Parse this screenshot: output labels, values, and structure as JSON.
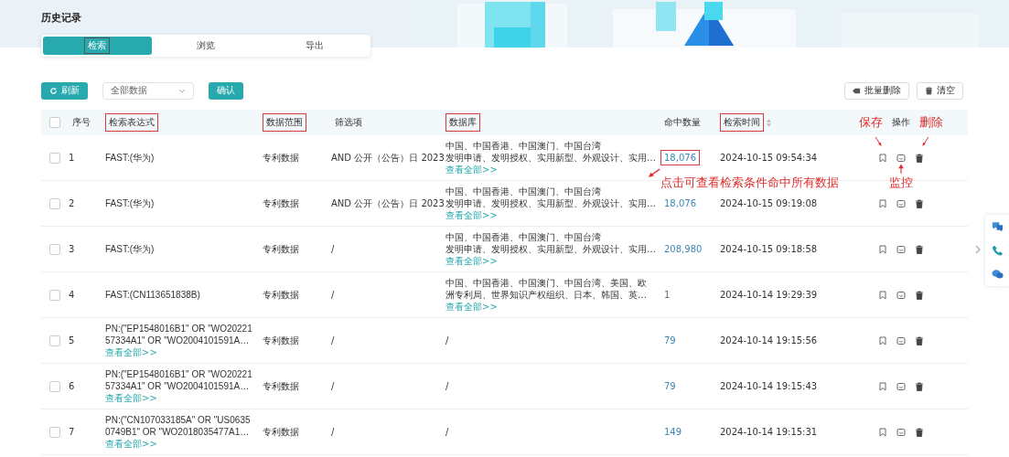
{
  "page": {
    "title": "历史记录"
  },
  "tabs": [
    {
      "label": "检索",
      "selected": true,
      "highlighted": true
    },
    {
      "label": "浏览",
      "selected": false,
      "highlighted": false
    },
    {
      "label": "导出",
      "selected": false,
      "highlighted": false
    }
  ],
  "toolbar": {
    "refresh": "刷新",
    "scope_select": {
      "value": "全部数据"
    },
    "confirm": "确认",
    "batch_delete": "批量删除",
    "clear": "清空"
  },
  "table": {
    "all_checked": false,
    "columns": [
      {
        "label": "序号",
        "highlighted": false,
        "sortable": false
      },
      {
        "label": "检索表达式",
        "highlighted": true,
        "sortable": false
      },
      {
        "label": "数据范围",
        "highlighted": true,
        "sortable": false
      },
      {
        "label": "筛选项",
        "highlighted": false,
        "sortable": false
      },
      {
        "label": "数据库",
        "highlighted": true,
        "sortable": false
      },
      {
        "label": "命中数量",
        "highlighted": false,
        "sortable": false
      },
      {
        "label": "检索时间",
        "highlighted": true,
        "sortable": true
      },
      {
        "label": "操作",
        "highlighted": false,
        "sortable": false
      }
    ],
    "rows": [
      {
        "checked": false,
        "index": "1",
        "expression": [
          "FAST:(华为)"
        ],
        "scope": "专利数据",
        "filter": "AND 公开（公告）日 2023",
        "database": [
          "中国、中国香港、中国澳门、中国台湾",
          "发明申请、发明授权、实用新型、外观设计、实用…"
        ],
        "database_more": "查看全部>>",
        "hits": "18,076",
        "hits_link": true,
        "hits_highlighted": true,
        "time": "2024-10-15 09:54:34"
      },
      {
        "checked": false,
        "index": "2",
        "expression": [
          "FAST:(华为)"
        ],
        "scope": "专利数据",
        "filter": "AND 公开（公告）日 2023",
        "database": [
          "中国、中国香港、中国澳门、中国台湾",
          "发明申请、发明授权、实用新型、外观设计、实用…"
        ],
        "database_more": "查看全部>>",
        "hits": "18,076",
        "hits_link": true,
        "hits_highlighted": false,
        "time": "2024-10-15 09:19:08"
      },
      {
        "checked": false,
        "index": "3",
        "expression": [
          "FAST:(华为)"
        ],
        "scope": "专利数据",
        "filter": "/",
        "database": [
          "中国、中国香港、中国澳门、中国台湾",
          "发明申请、发明授权、实用新型、外观设计、实用…"
        ],
        "database_more": "查看全部>>",
        "hits": "208,980",
        "hits_link": true,
        "hits_highlighted": false,
        "time": "2024-10-15 09:18:58"
      },
      {
        "checked": false,
        "index": "4",
        "expression": [
          "FAST:(CN113651838B)"
        ],
        "scope": "专利数据",
        "filter": "/",
        "database": [
          "中国、中国香港、中国澳门、中国台湾、美国、欧",
          "洲专利局、世界知识产权组织、日本、韩国、英…"
        ],
        "database_more": "查看全部>>",
        "hits": "1",
        "hits_link": false,
        "hits_highlighted": false,
        "time": "2024-10-14 19:29:39"
      },
      {
        "checked": false,
        "index": "5",
        "expression": [
          "PN:(\"EP1548016B1\" OR \"WO20221",
          "57334A1\" OR \"WO2004101591A…"
        ],
        "expression_more": "查看全部>>",
        "scope": "专利数据",
        "filter": "/",
        "database": [
          "/"
        ],
        "hits": "79",
        "hits_link": true,
        "hits_highlighted": false,
        "time": "2024-10-14 19:15:56"
      },
      {
        "checked": false,
        "index": "6",
        "expression": [
          "PN:(\"EP1548016B1\" OR \"WO20221",
          "57334A1\" OR \"WO2004101591A…"
        ],
        "expression_more": "查看全部>>",
        "scope": "专利数据",
        "filter": "/",
        "database": [
          "/"
        ],
        "hits": "79",
        "hits_link": true,
        "hits_highlighted": false,
        "time": "2024-10-14 19:15:43"
      },
      {
        "checked": false,
        "index": "7",
        "expression": [
          "PN:(\"CN107033185A\" OR \"US0635",
          "0749B1\" OR \"WO2018035477A1…"
        ],
        "expression_more": "查看全部>>",
        "scope": "专利数据",
        "filter": "/",
        "database": [
          "/"
        ],
        "hits": "149",
        "hits_link": true,
        "hits_highlighted": false,
        "time": "2024-10-14 19:15:31"
      }
    ]
  },
  "annotations": {
    "save": "保存",
    "delete": "删除",
    "monitor": "监控",
    "hit_hint": "点击可查看检索条件命中所有数据"
  }
}
